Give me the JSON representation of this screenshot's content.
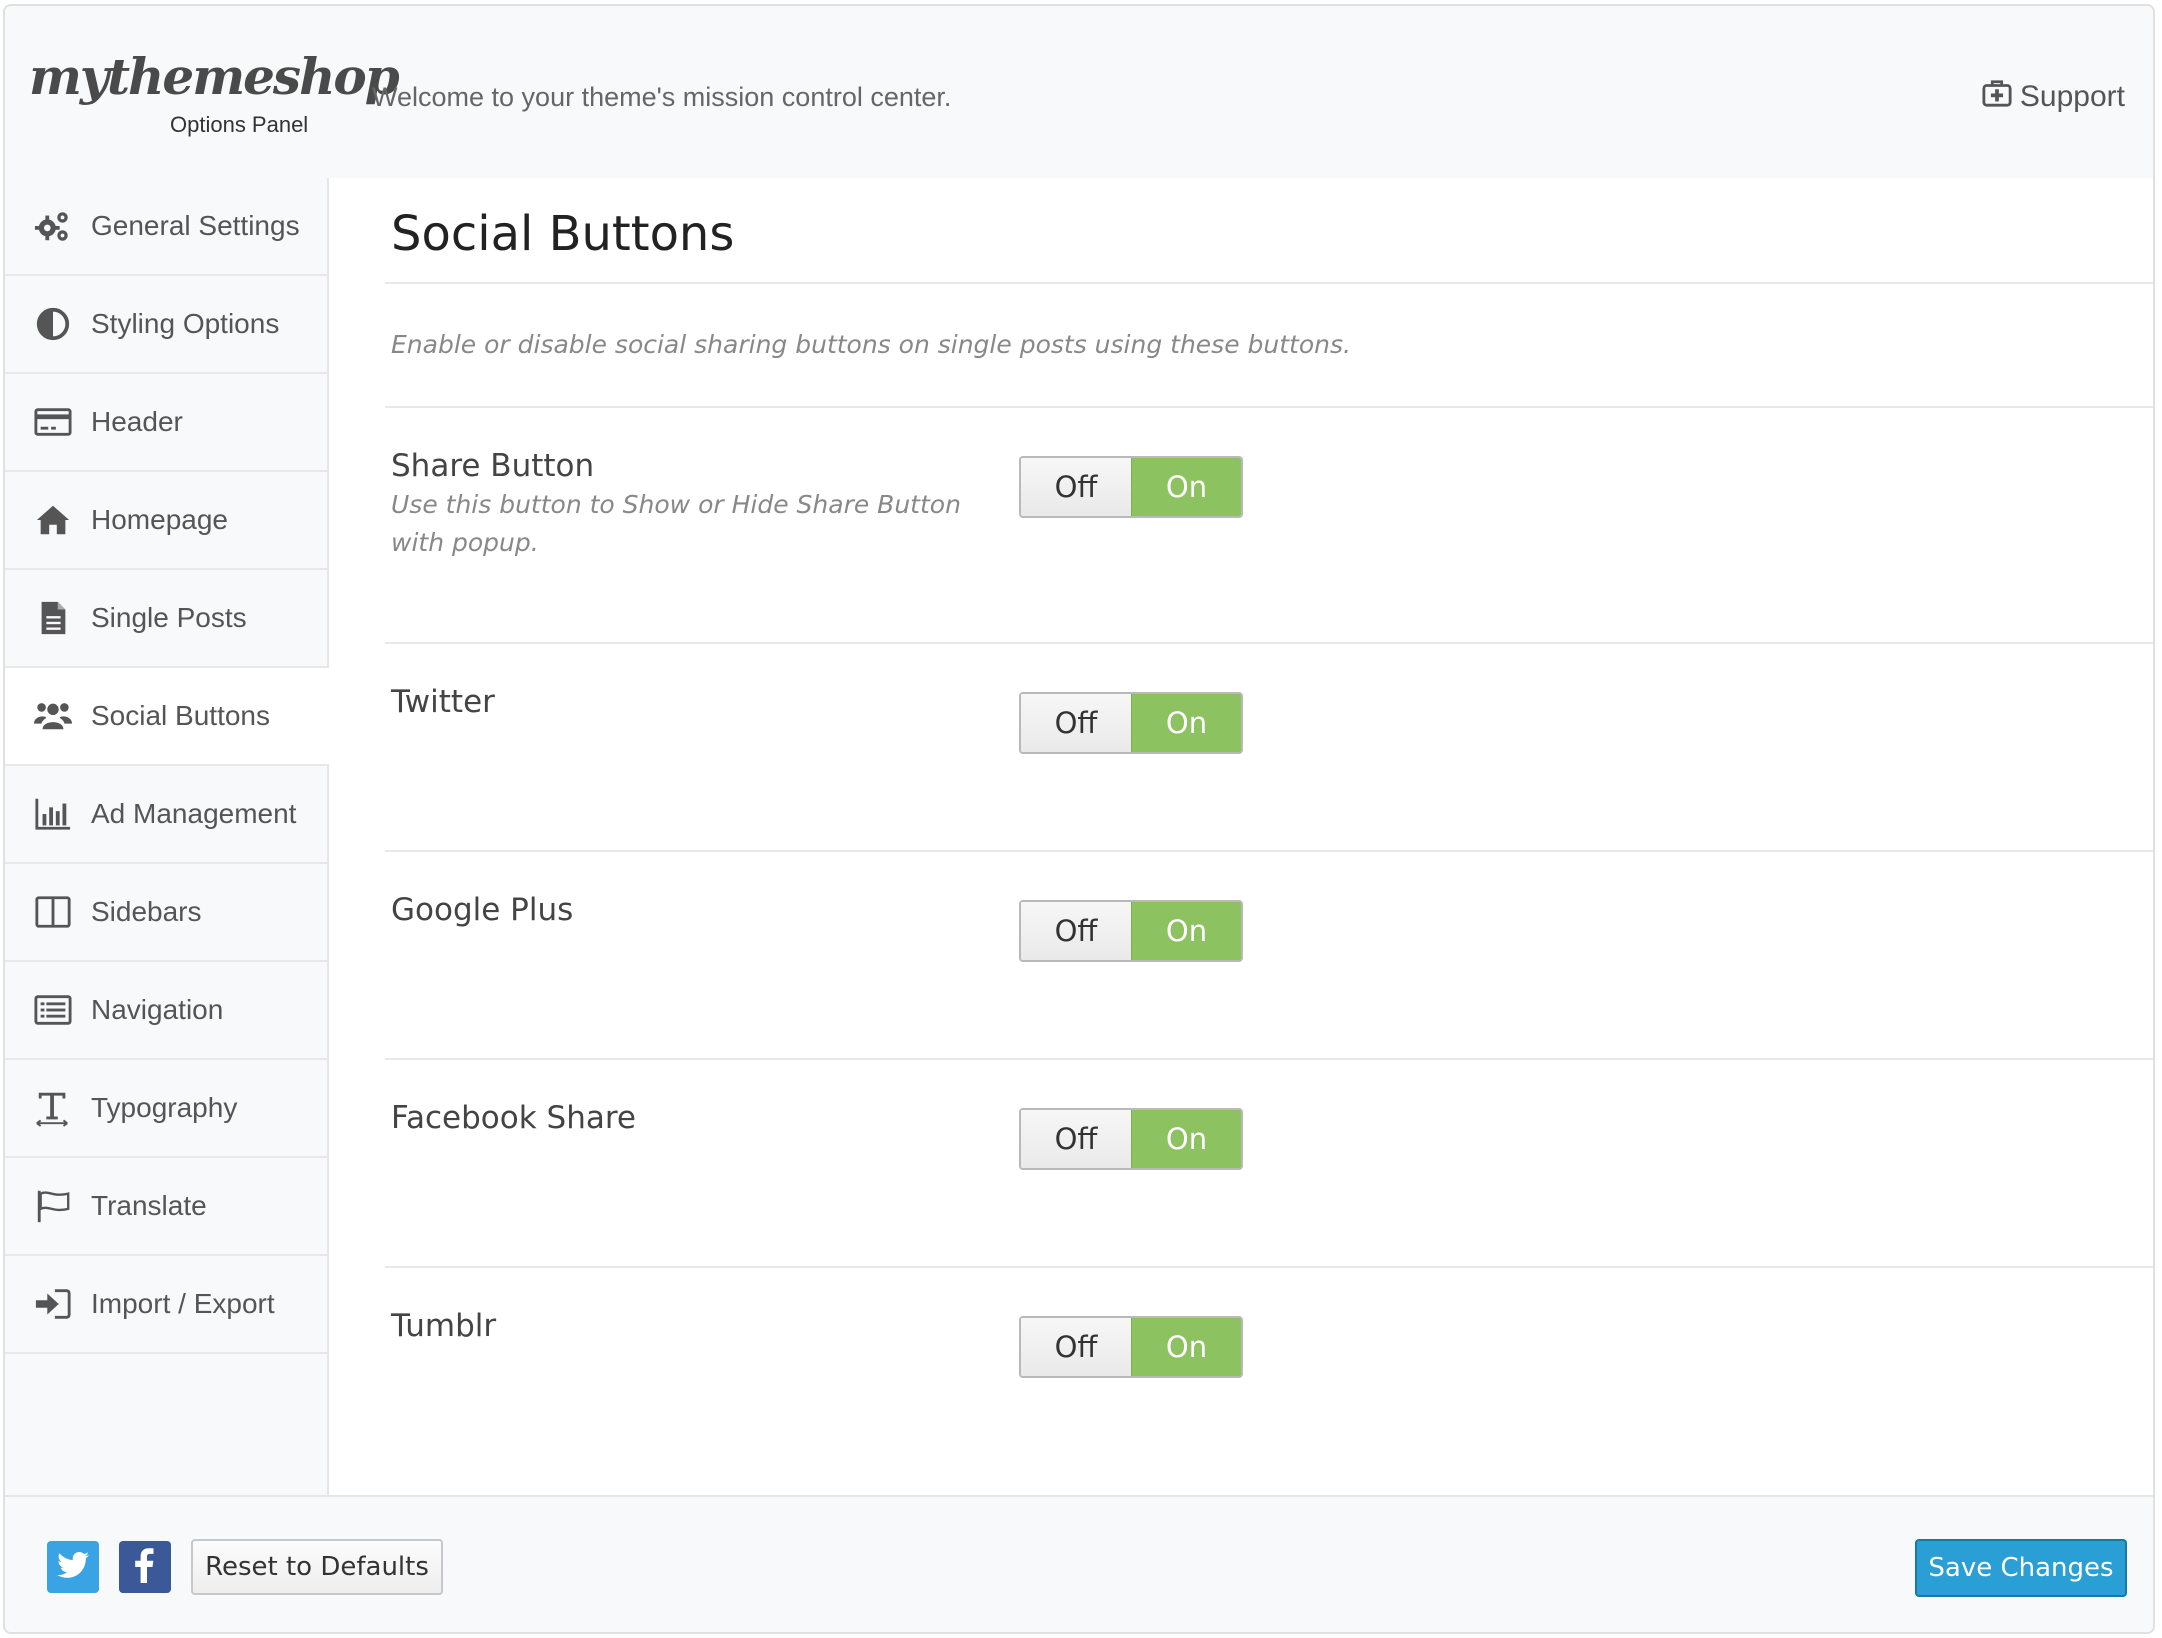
{
  "header": {
    "logo": "mythemeshop",
    "logo_subtitle": "Options Panel",
    "welcome": "Welcome to your theme's mission control center.",
    "support_label": "Support",
    "support_icon": "first-aid-kit-icon"
  },
  "sidebar": {
    "items": [
      {
        "label": "General Settings",
        "icon": "gears-icon"
      },
      {
        "label": "Styling Options",
        "icon": "contrast-icon"
      },
      {
        "label": "Header",
        "icon": "header-card-icon"
      },
      {
        "label": "Homepage",
        "icon": "home-icon"
      },
      {
        "label": "Single Posts",
        "icon": "document-icon"
      },
      {
        "label": "Social Buttons",
        "icon": "users-icon",
        "active": true
      },
      {
        "label": "Ad Management",
        "icon": "bar-chart-icon"
      },
      {
        "label": "Sidebars",
        "icon": "columns-icon"
      },
      {
        "label": "Navigation",
        "icon": "list-icon"
      },
      {
        "label": "Typography",
        "icon": "text-height-icon"
      },
      {
        "label": "Translate",
        "icon": "flag-icon"
      },
      {
        "label": "Import / Export",
        "icon": "sign-in-icon"
      }
    ]
  },
  "main": {
    "title": "Social Buttons",
    "description": "Enable or disable social sharing buttons on single posts using these buttons.",
    "options": [
      {
        "title": "Share Button",
        "description": "Use this button to Show or Hide Share Button with popup.",
        "value": "On"
      },
      {
        "title": "Twitter",
        "description": "",
        "value": "On"
      },
      {
        "title": "Google Plus",
        "description": "",
        "value": "On"
      },
      {
        "title": "Facebook Share",
        "description": "",
        "value": "On"
      },
      {
        "title": "Tumblr",
        "description": "",
        "value": "On"
      }
    ],
    "toggle_off_label": "Off",
    "toggle_on_label": "On"
  },
  "footer": {
    "twitter_icon": "twitter-icon",
    "facebook_icon": "facebook-icon",
    "reset_label": "Reset to Defaults",
    "save_label": "Save Changes"
  },
  "colors": {
    "toggle_on": "#8cc360",
    "save_button": "#2a9fd6",
    "twitter": "#3aa3e3",
    "facebook": "#3b5998"
  }
}
